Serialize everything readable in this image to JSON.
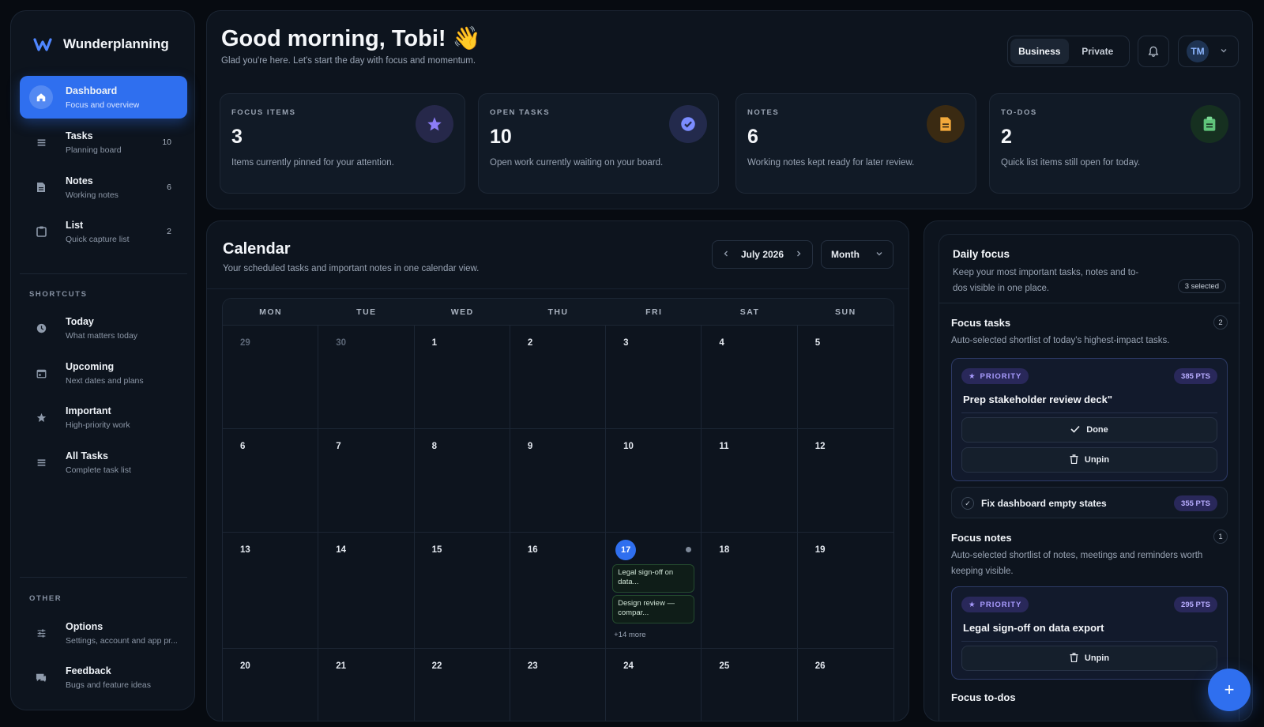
{
  "app": {
    "name": "Wunderplanning"
  },
  "sidebar": {
    "main": [
      {
        "title": "Dashboard",
        "sub": "Focus and overview",
        "count": "",
        "icon": "home-icon"
      },
      {
        "title": "Tasks",
        "sub": "Planning board",
        "count": "10",
        "icon": "tasks-icon"
      },
      {
        "title": "Notes",
        "sub": "Working notes",
        "count": "6",
        "icon": "note-icon"
      },
      {
        "title": "List",
        "sub": "Quick capture list",
        "count": "2",
        "icon": "clipboard-icon"
      }
    ],
    "shortcuts_label": "SHORTCUTS",
    "shortcuts": [
      {
        "title": "Today",
        "sub": "What matters today",
        "icon": "clock-icon"
      },
      {
        "title": "Upcoming",
        "sub": "Next dates and plans",
        "icon": "calendar-icon"
      },
      {
        "title": "Important",
        "sub": "High-priority work",
        "icon": "star-icon"
      },
      {
        "title": "All Tasks",
        "sub": "Complete task list",
        "icon": "list-icon"
      }
    ],
    "other_label": "OTHER",
    "other": [
      {
        "title": "Options",
        "sub": "Settings, account and app pr...",
        "icon": "sliders-icon"
      },
      {
        "title": "Feedback",
        "sub": "Bugs and feature ideas",
        "icon": "chat-icon"
      }
    ]
  },
  "header": {
    "greeting": "Good morning, Tobi! 👋",
    "subtitle": "Glad you're here. Let's start the day with focus and momentum.",
    "toggle": [
      "Business",
      "Private"
    ],
    "avatar": "TM"
  },
  "stats": [
    {
      "label": "FOCUS ITEMS",
      "value": "3",
      "desc": "Items currently pinned for your attention.",
      "icon": "star-icon",
      "color": "#8b7cf6",
      "bg": "#26284a"
    },
    {
      "label": "OPEN TASKS",
      "value": "10",
      "desc": "Open work currently waiting on your board.",
      "icon": "check-badge-icon",
      "color": "#7b8cff",
      "bg": "#232a4c"
    },
    {
      "label": "NOTES",
      "value": "6",
      "desc": "Working notes kept ready for later review.",
      "icon": "document-icon",
      "color": "#f2a93b",
      "bg": "#3a2a12"
    },
    {
      "label": "TO-DOS",
      "value": "2",
      "desc": "Quick list items still open for today.",
      "icon": "clipboard-icon",
      "color": "#5fc47a",
      "bg": "#163020"
    }
  ],
  "calendar": {
    "title": "Calendar",
    "subtitle": "Your scheduled tasks and important notes in one calendar view.",
    "month": "July 2026",
    "view": "Month",
    "weekdays": [
      "MON",
      "TUE",
      "WED",
      "THU",
      "FRI",
      "SAT",
      "SUN"
    ],
    "weeks": [
      [
        "29",
        "30",
        "1",
        "2",
        "3",
        "4",
        "5"
      ],
      [
        "6",
        "7",
        "8",
        "9",
        "10",
        "11",
        "12"
      ],
      [
        "13",
        "14",
        "15",
        "16",
        "17",
        "18",
        "19"
      ],
      [
        "20",
        "21",
        "22",
        "23",
        "24",
        "25",
        "26"
      ]
    ],
    "events": [
      "Legal sign-off on data...",
      "Design review — compar..."
    ],
    "more": "+14 more"
  },
  "focus": {
    "title": "Daily focus",
    "subtitle": "Keep your most important tasks, notes and to-dos visible in one place.",
    "selected": "3 selected",
    "tasks_title": "Focus tasks",
    "tasks_count": "2",
    "tasks_sub": "Auto-selected shortlist of today's highest-impact tasks.",
    "priority_label": "PRIORITY",
    "task1": {
      "pts": "385 PTS",
      "title": "Prep stakeholder review deck\"",
      "done": "Done",
      "unpin": "Unpin"
    },
    "task2": {
      "title": "Fix dashboard empty states",
      "pts": "355 PTS"
    },
    "notes_title": "Focus notes",
    "notes_count": "1",
    "notes_sub": "Auto-selected shortlist of notes, meetings and reminders worth keeping visible.",
    "note1": {
      "pts": "295 PTS",
      "title": "Legal sign-off on data export",
      "unpin": "Unpin"
    },
    "todos_title": "Focus to-dos"
  }
}
